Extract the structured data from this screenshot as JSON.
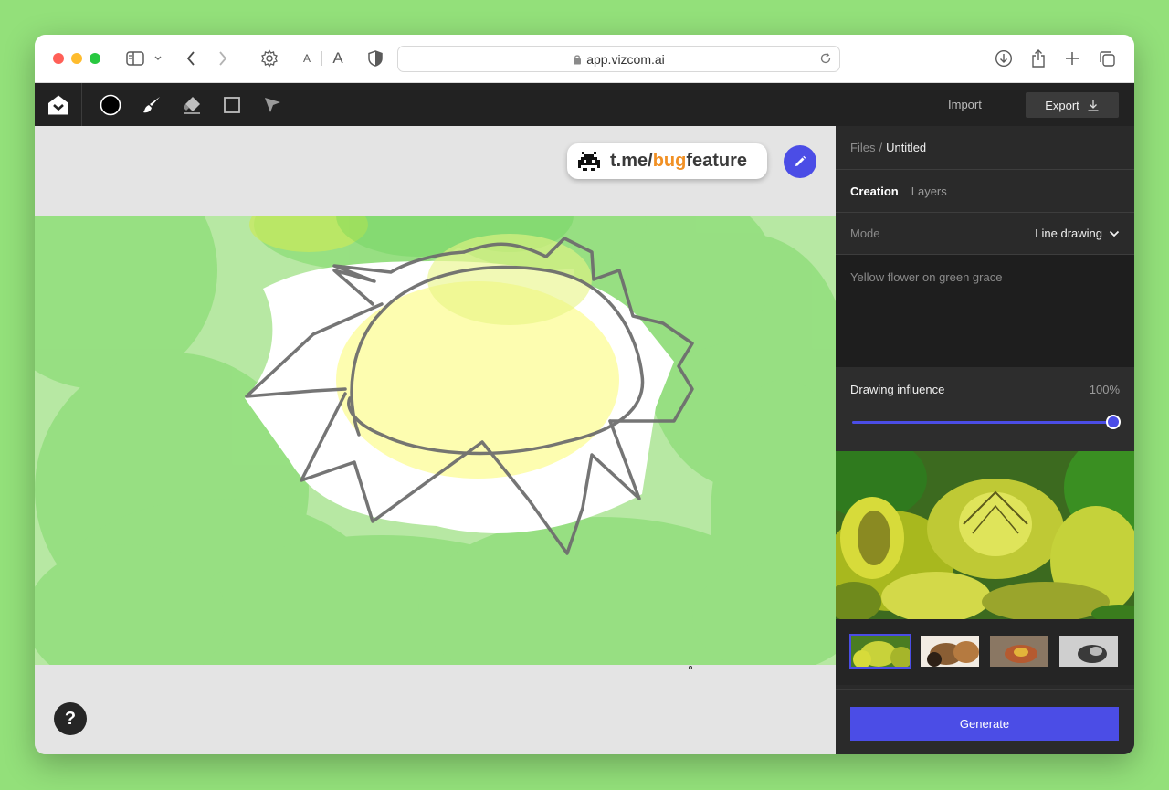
{
  "browser": {
    "url": "app.vizcom.ai",
    "text_size_small": "A",
    "text_size_large": "A"
  },
  "toolbar": {
    "import_label": "Import",
    "export_label": "Export",
    "tools": [
      "color-swatch",
      "brush",
      "eraser",
      "rectangle",
      "select"
    ]
  },
  "canvas": {
    "watermark_prefix": "t.me/",
    "watermark_highlight": "bug",
    "watermark_suffix": "feature",
    "help_label": "?"
  },
  "panel": {
    "breadcrumb_root": "Files",
    "breadcrumb_separator": "/",
    "breadcrumb_current": "Untitled",
    "tabs": [
      {
        "label": "Creation",
        "active": true
      },
      {
        "label": "Layers",
        "active": false
      }
    ],
    "mode_label": "Mode",
    "mode_value": "Line drawing",
    "prompt": "Yellow flower on green grace",
    "influence_label": "Drawing influence",
    "influence_value": "100%",
    "influence_level": 1.0,
    "thumbnails_count": 4,
    "selected_thumbnail": 0,
    "generate_label": "Generate"
  },
  "colors": {
    "accent": "#4b4de6",
    "app_bar": "#222222",
    "panel": "#2a2a2a",
    "watermark_orange": "#f19024",
    "desktop": "#93e07a"
  }
}
